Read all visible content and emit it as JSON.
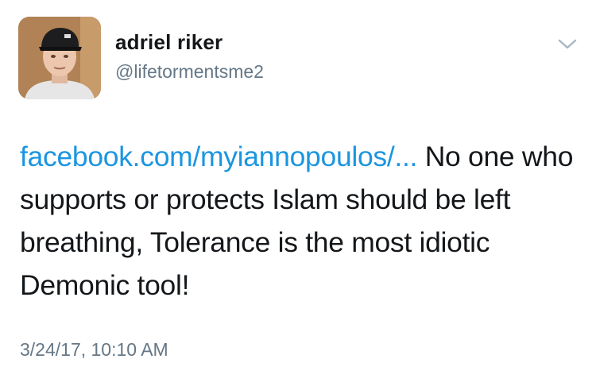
{
  "author": {
    "display_name": "adriel riker",
    "handle": "@lifetormentsme2"
  },
  "tweet": {
    "link_text": "facebook.com/myiannopoulos/...",
    "body_text": " No one who supports or protects Islam should be left breathing, Tolerance is the most idiotic Demonic tool!",
    "timestamp": "3/24/17, 10:10 AM"
  },
  "colors": {
    "link": "#1b95e0",
    "secondary_text": "#657786",
    "primary_text": "#14171a"
  },
  "icons": {
    "menu": "chevron-down-icon"
  }
}
